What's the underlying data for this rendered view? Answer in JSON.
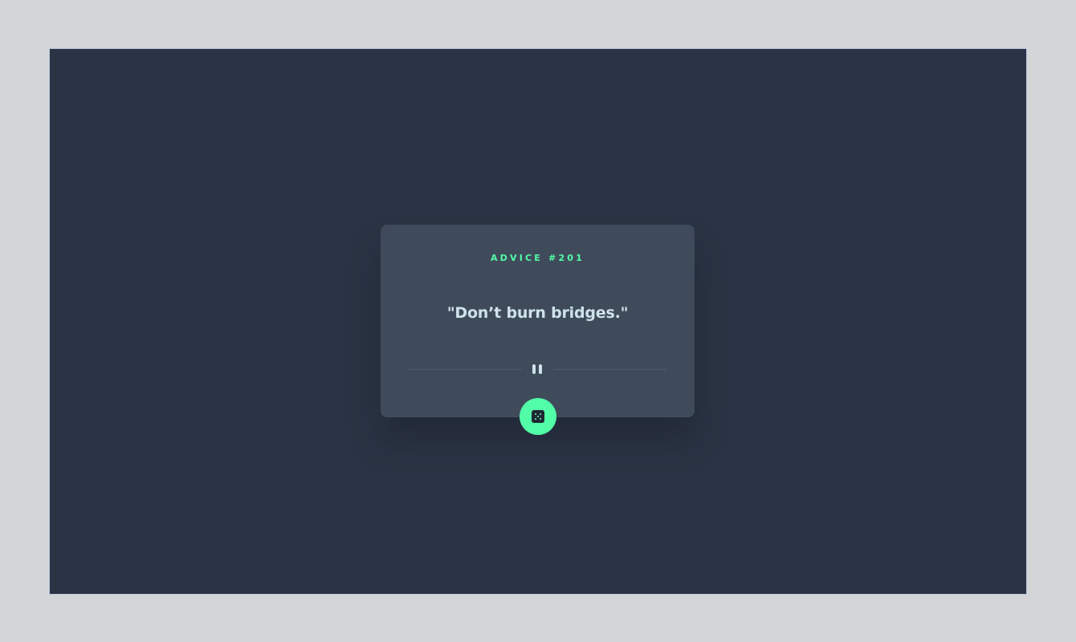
{
  "advice": {
    "label": "ADVICE #201",
    "quote": "\"Don’t burn bridges.\""
  },
  "icons": {
    "divider": "pause-icon",
    "button": "dice-icon"
  },
  "colors": {
    "background": "#2b3444",
    "card": "#3f4b5a",
    "accent": "#52ffa8",
    "text": "#cee3e9"
  }
}
